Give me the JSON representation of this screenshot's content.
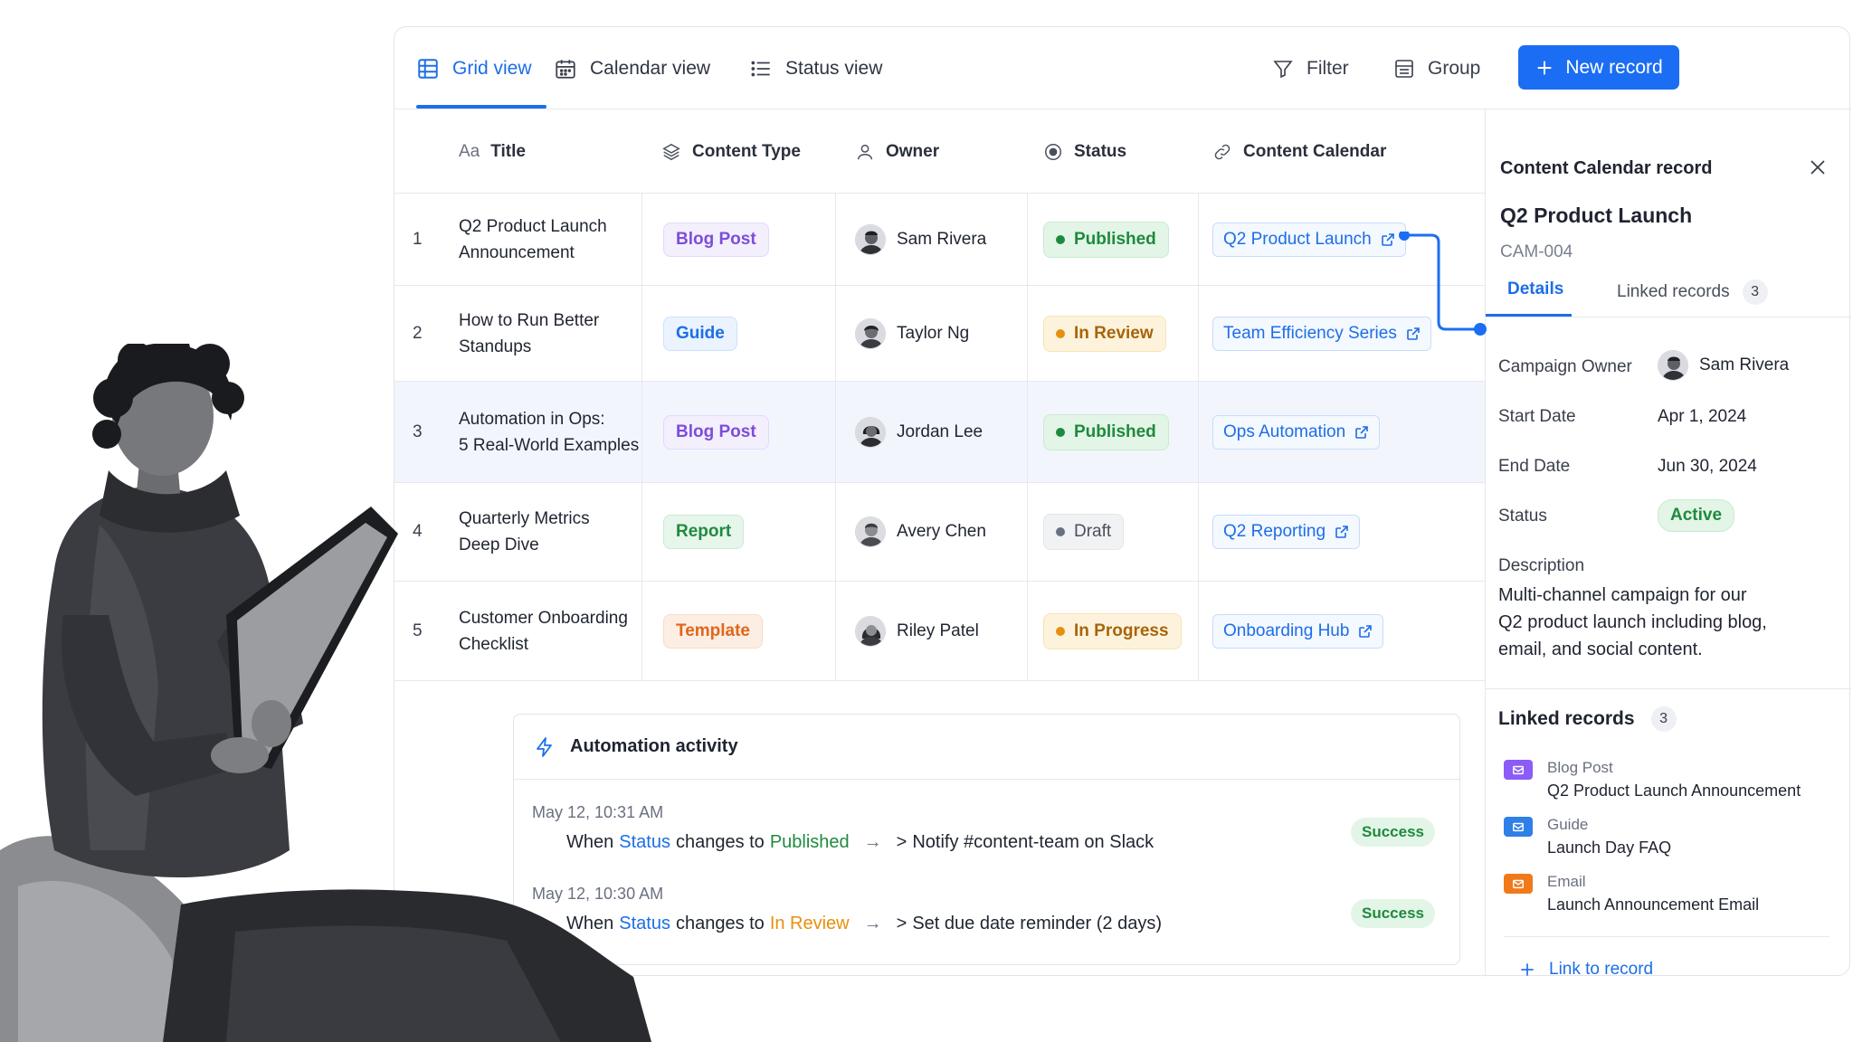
{
  "toolbar": {
    "tabs": [
      {
        "label": "Grid view",
        "icon": "grid-icon"
      },
      {
        "label": "Calendar view",
        "icon": "calendar-icon"
      },
      {
        "label": "Status view",
        "icon": "list-icon"
      }
    ],
    "filter_label": "Filter",
    "group_label": "Group",
    "new_record_label": "New record"
  },
  "table": {
    "columns": [
      "Title",
      "Content Type",
      "Owner",
      "Status",
      "Content Calendar"
    ],
    "title_prefix": "Aa",
    "rows": [
      {
        "num": "1",
        "title_1": "Q2 Product Launch",
        "title_2": "Announcement",
        "type": "Blog Post",
        "owner": "Sam Rivera",
        "status": "Published",
        "calendar": "Q2 Product Launch"
      },
      {
        "num": "2",
        "title_1": "How to Run Better",
        "title_2": "Standups",
        "type": "Guide",
        "owner": "Taylor Ng",
        "status": "In Review",
        "calendar": "Team Efficiency Series"
      },
      {
        "num": "3",
        "title_1": "Automation in Ops:",
        "title_2": "5 Real-World Examples",
        "type": "Blog Post",
        "owner": "Jordan Lee",
        "status": "Published",
        "calendar": "Ops Automation"
      },
      {
        "num": "4",
        "title_1": "Quarterly Metrics",
        "title_2": "Deep Dive",
        "type": "Report",
        "owner": "Avery Chen",
        "status": "Draft",
        "calendar": "Q2 Reporting"
      },
      {
        "num": "5",
        "title_1": "Customer Onboarding",
        "title_2": "Checklist",
        "type": "Template",
        "owner": "Riley Patel",
        "status": "In Progress",
        "calendar": "Onboarding Hub"
      }
    ]
  },
  "record": {
    "header": "Content Calendar record",
    "title": "Q2 Product Launch",
    "id": "CAM-004",
    "tabs": {
      "details": "Details",
      "linked": "Linked records",
      "linked_count": "3"
    },
    "fields": {
      "owner_label": "Campaign Owner",
      "owner": "Sam Rivera",
      "start_label": "Start Date",
      "start": "Apr 1, 2024",
      "end_label": "End Date",
      "end": "Jun 30, 2024",
      "status_label": "Status",
      "status": "Active",
      "desc_label": "Description",
      "desc": "Multi-channel campaign for our Q2 product launch including blog, email, and social content."
    },
    "linked_header": "Linked records",
    "linked_count": "3",
    "linked": [
      {
        "type": "Blog Post",
        "name": "Q2 Product Launch Announcement",
        "color": "#8b5cf6"
      },
      {
        "type": "Guide",
        "name": "Launch Day FAQ",
        "color": "#2f7fe6"
      },
      {
        "type": "Email",
        "name": "Launch Announcement Email",
        "color": "#f07a1a"
      }
    ],
    "link_action": "Link to record"
  },
  "automation": {
    "title": "Automation activity",
    "activities": [
      {
        "time": "May 12,  10:31 AM",
        "when": "When",
        "field": "Status",
        "changes": "changes to",
        "value": "Published",
        "action": "Notify #content-team on Slack",
        "result": "Success"
      },
      {
        "time": "May 12,  10:30 AM",
        "when": "When",
        "field": "Status",
        "changes": "changes to",
        "value": "In Review",
        "action": "Set due date reminder (2 days)",
        "result": "Success"
      }
    ]
  },
  "colors": {
    "accent": "#1c6ee8",
    "published": "#1f8a3e",
    "in_review": "#e6900f",
    "draft": "#6a7080"
  }
}
